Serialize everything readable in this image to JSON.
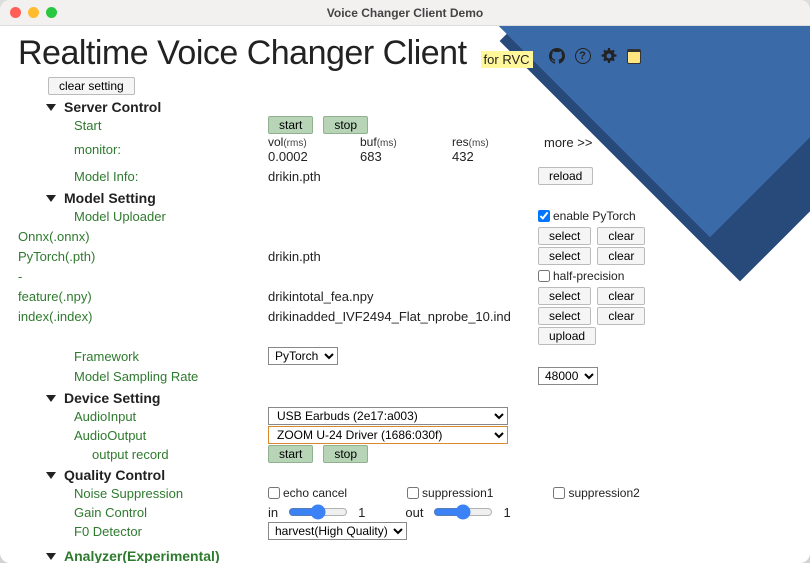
{
  "window_title": "Voice Changer Client Demo",
  "heading": "Realtime Voice Changer Client",
  "subtitle": "for RVC",
  "clear_setting": "clear setting",
  "sections": {
    "server": {
      "title": "Server Control",
      "start_label": "Start",
      "start_btn": "start",
      "stop_btn": "stop",
      "monitor_label": "monitor:",
      "vol_head": "vol",
      "buf_head": "buf",
      "res_head": "res",
      "unit": "(rms)",
      "unit_ms": "(ms)",
      "vol_val": "0.0002",
      "buf_val": "683",
      "res_val": "432",
      "more": "more >>",
      "model_info_label": "Model Info:",
      "model_info_value": "drikin.pth",
      "reload_btn": "reload"
    },
    "model": {
      "title": "Model Setting",
      "uploader_label": "Model Uploader",
      "enable_pytorch": "enable PyTorch",
      "onnx_label": "Onnx(.onnx)",
      "pytorch_label": "PyTorch(.pth)",
      "pytorch_value": "drikin.pth",
      "dash_label": "-",
      "half_precision": "half-precision",
      "feature_label": "feature(.npy)",
      "feature_value": "drikintotal_fea.npy",
      "index_label": "index(.index)",
      "index_value": "drikinadded_IVF2494_Flat_nprobe_10.ind",
      "select_btn": "select",
      "clear_btn": "clear",
      "upload_btn": "upload",
      "framework_label": "Framework",
      "framework_value": "PyTorch",
      "sampling_label": "Model Sampling Rate",
      "sampling_value": "48000"
    },
    "device": {
      "title": "Device Setting",
      "input_label": "AudioInput",
      "input_value": "USB Earbuds (2e17:a003)",
      "output_label": "AudioOutput",
      "output_value": "ZOOM U-24 Driver (1686:030f)",
      "record_label": "output record",
      "start_btn": "start",
      "stop_btn": "stop"
    },
    "quality": {
      "title": "Quality Control",
      "noise_label": "Noise Suppression",
      "echo_cancel": "echo cancel",
      "supp1": "suppression1",
      "supp2": "suppression2",
      "gain_label": "Gain Control",
      "in": "in",
      "out": "out",
      "in_val": "1",
      "out_val": "1",
      "f0_label": "F0 Detector",
      "f0_value": "harvest(High Quality)"
    },
    "analyzer": {
      "title": "Analyzer(Experimental)"
    }
  }
}
